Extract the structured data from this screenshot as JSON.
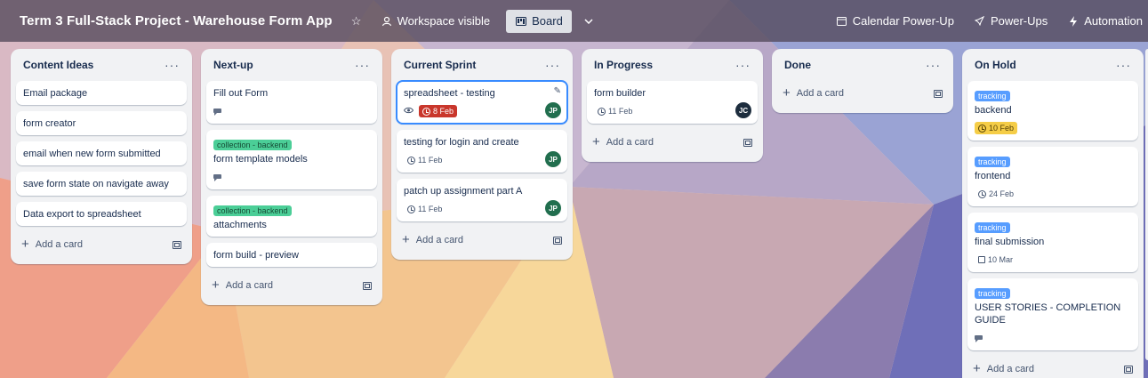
{
  "header": {
    "board_title": "Term 3 Full-Stack Project - Warehouse Form App",
    "visibility": "Workspace visible",
    "view": "Board",
    "calendar": "Calendar Power-Up",
    "powerups": "Power-Ups",
    "automation": "Automation"
  },
  "lists": [
    {
      "title": "Content Ideas",
      "add_card": "Add a card",
      "cards": [
        {
          "title": "Email package"
        },
        {
          "title": "form creator"
        },
        {
          "title": "email when new form submitted"
        },
        {
          "title": "save form state on navigate away"
        },
        {
          "title": "Data export to spreadsheet"
        }
      ]
    },
    {
      "title": "Next-up",
      "add_card": "Add a card",
      "cards": [
        {
          "title": "Fill out Form",
          "description": true
        },
        {
          "label": "collection - backend",
          "label_color": "green",
          "title": "form template models",
          "description": true
        },
        {
          "label": "collection - backend",
          "label_color": "green",
          "title": "attachments"
        },
        {
          "title": "form build - preview"
        }
      ]
    },
    {
      "title": "Current Sprint",
      "add_card": "Add a card",
      "cards": [
        {
          "title": "spreadsheet - testing",
          "watch": true,
          "due": "8 Feb",
          "due_style": "red",
          "member": "JP",
          "focused": true
        },
        {
          "title": "testing for login and create",
          "due": "11 Feb",
          "member": "JP"
        },
        {
          "title": "patch up assignment part A",
          "due": "11 Feb",
          "member": "JP"
        }
      ]
    },
    {
      "title": "In Progress",
      "add_card": "Add a card",
      "cards": [
        {
          "title": "form builder",
          "due": "11 Feb",
          "member": "JC"
        }
      ]
    },
    {
      "title": "Done",
      "add_card": "Add a card",
      "cards": []
    },
    {
      "title": "On Hold",
      "add_card": "Add a card",
      "cards": [
        {
          "label": "tracking",
          "label_color": "blue",
          "title": "backend",
          "due": "10 Feb",
          "due_style": "yellow"
        },
        {
          "label": "tracking",
          "label_color": "blue",
          "title": "frontend",
          "due": "24 Feb"
        },
        {
          "label": "tracking",
          "label_color": "blue",
          "title": "final submission",
          "due": "10 Mar",
          "due_icon": "checkbox"
        },
        {
          "label": "tracking",
          "label_color": "blue",
          "title": "USER STORIES - COMPLETION GUIDE",
          "description": true
        }
      ]
    }
  ],
  "colors": {
    "header_bg": "#52485a",
    "list_bg": "#f1f2f4",
    "label_green": "#4bce97",
    "label_blue": "#579dff",
    "due_red": "#c9372c",
    "due_yellow": "#f5cd47",
    "avatar_jp": "#216e4e",
    "avatar_jc": "#1d2d3e"
  }
}
